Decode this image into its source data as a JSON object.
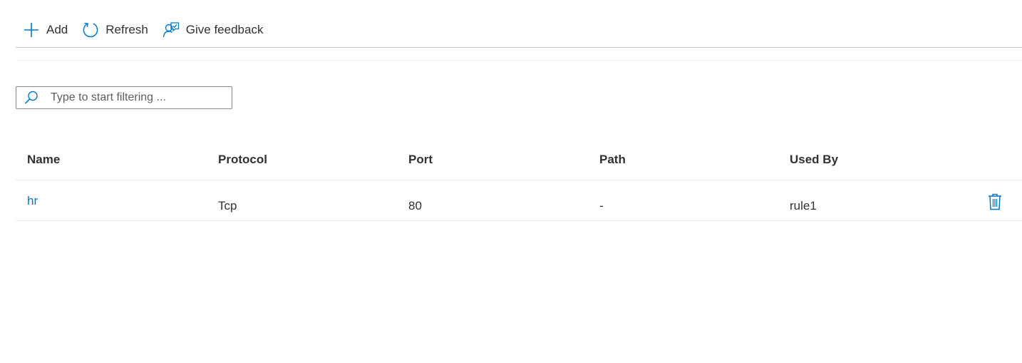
{
  "toolbar": {
    "add_label": "Add",
    "refresh_label": "Refresh",
    "feedback_label": "Give feedback"
  },
  "filter": {
    "placeholder": "Type to start filtering ...",
    "value": ""
  },
  "table": {
    "columns": [
      "Name",
      "Protocol",
      "Port",
      "Path",
      "Used By"
    ],
    "rows": [
      {
        "name": "hr",
        "protocol": "Tcp",
        "port": "80",
        "path": "-",
        "used_by": "rule1"
      }
    ]
  },
  "icons": {
    "add": "plus-icon",
    "refresh": "refresh-icon",
    "feedback": "feedback-icon",
    "search": "search-icon",
    "delete": "trash-icon"
  },
  "colors": {
    "accent": "#0078d4",
    "text": "#323130",
    "divider": "#c8c6c4"
  }
}
